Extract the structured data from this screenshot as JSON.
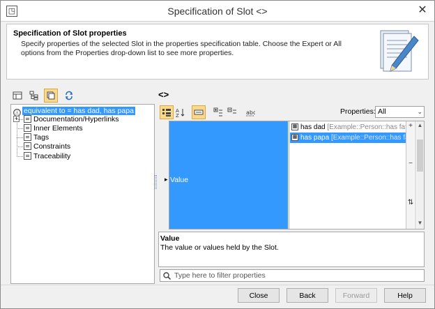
{
  "window": {
    "title": "Specification of Slot <>",
    "close_glyph": "✕",
    "app_icon": "magicdraw-icon"
  },
  "header": {
    "title": "Specification of Slot properties",
    "description": "Specify properties of the selected Slot in the properties specification table. Choose the Expert or All options from the Properties drop-down list to see more properties.",
    "icon": "document-pencil-icon"
  },
  "left_toolbar": {
    "buttons": [
      {
        "icon": "table-view-icon",
        "active": false
      },
      {
        "icon": "tree-view-icon",
        "active": false
      },
      {
        "icon": "copy-elements-icon",
        "active": true
      },
      {
        "icon": "refresh-icon",
        "active": false
      }
    ]
  },
  "element_name": "<>",
  "tree": {
    "root_label": "equivalent to = has dad, has papa",
    "items": [
      {
        "label": "Documentation/Hyperlinks",
        "expandable": true
      },
      {
        "label": "Inner Elements",
        "expandable": false
      },
      {
        "label": "Tags",
        "expandable": false
      },
      {
        "label": "Constraints",
        "expandable": false
      },
      {
        "label": "Traceability",
        "expandable": false
      }
    ]
  },
  "properties_toolbar": {
    "label": "Properties:",
    "selected": "All"
  },
  "property_grid": {
    "rows": [
      {
        "name": "Value",
        "values": [
          {
            "name": "has dad",
            "type": "[Example::Person::has fath",
            "selected": false
          },
          {
            "name": "has papa",
            "type": "[Example::Person::has fath",
            "selected": true
          }
        ]
      }
    ],
    "side_buttons": [
      "+",
      "−",
      "⇅"
    ]
  },
  "description": {
    "title": "Value",
    "text": "The value or values held by the Slot."
  },
  "filter": {
    "placeholder": "Type here to filter properties"
  },
  "buttons": {
    "close": "Close",
    "back": "Back",
    "forward": "Forward",
    "help": "Help"
  }
}
